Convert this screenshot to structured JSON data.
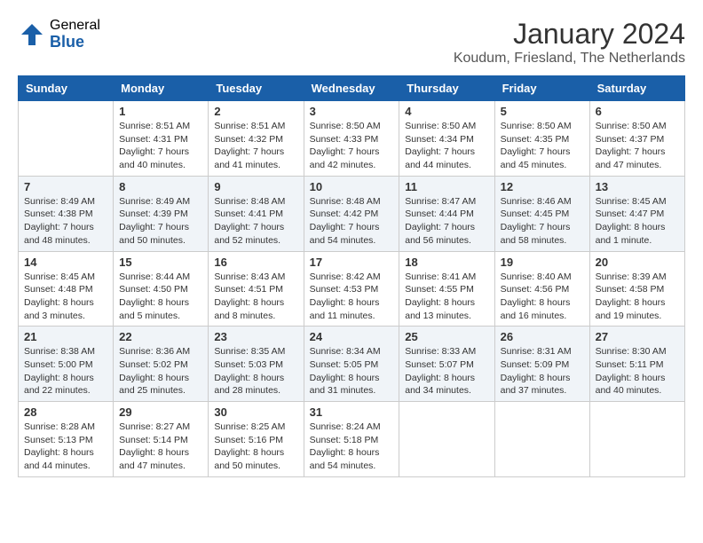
{
  "header": {
    "logo": {
      "general": "General",
      "blue": "Blue"
    },
    "title": "January 2024",
    "location": "Koudum, Friesland, The Netherlands"
  },
  "calendar": {
    "days_of_week": [
      "Sunday",
      "Monday",
      "Tuesday",
      "Wednesday",
      "Thursday",
      "Friday",
      "Saturday"
    ],
    "weeks": [
      [
        {
          "day": "",
          "info": ""
        },
        {
          "day": "1",
          "info": "Sunrise: 8:51 AM\nSunset: 4:31 PM\nDaylight: 7 hours\nand 40 minutes."
        },
        {
          "day": "2",
          "info": "Sunrise: 8:51 AM\nSunset: 4:32 PM\nDaylight: 7 hours\nand 41 minutes."
        },
        {
          "day": "3",
          "info": "Sunrise: 8:50 AM\nSunset: 4:33 PM\nDaylight: 7 hours\nand 42 minutes."
        },
        {
          "day": "4",
          "info": "Sunrise: 8:50 AM\nSunset: 4:34 PM\nDaylight: 7 hours\nand 44 minutes."
        },
        {
          "day": "5",
          "info": "Sunrise: 8:50 AM\nSunset: 4:35 PM\nDaylight: 7 hours\nand 45 minutes."
        },
        {
          "day": "6",
          "info": "Sunrise: 8:50 AM\nSunset: 4:37 PM\nDaylight: 7 hours\nand 47 minutes."
        }
      ],
      [
        {
          "day": "7",
          "info": "Sunrise: 8:49 AM\nSunset: 4:38 PM\nDaylight: 7 hours\nand 48 minutes."
        },
        {
          "day": "8",
          "info": "Sunrise: 8:49 AM\nSunset: 4:39 PM\nDaylight: 7 hours\nand 50 minutes."
        },
        {
          "day": "9",
          "info": "Sunrise: 8:48 AM\nSunset: 4:41 PM\nDaylight: 7 hours\nand 52 minutes."
        },
        {
          "day": "10",
          "info": "Sunrise: 8:48 AM\nSunset: 4:42 PM\nDaylight: 7 hours\nand 54 minutes."
        },
        {
          "day": "11",
          "info": "Sunrise: 8:47 AM\nSunset: 4:44 PM\nDaylight: 7 hours\nand 56 minutes."
        },
        {
          "day": "12",
          "info": "Sunrise: 8:46 AM\nSunset: 4:45 PM\nDaylight: 7 hours\nand 58 minutes."
        },
        {
          "day": "13",
          "info": "Sunrise: 8:45 AM\nSunset: 4:47 PM\nDaylight: 8 hours\nand 1 minute."
        }
      ],
      [
        {
          "day": "14",
          "info": "Sunrise: 8:45 AM\nSunset: 4:48 PM\nDaylight: 8 hours\nand 3 minutes."
        },
        {
          "day": "15",
          "info": "Sunrise: 8:44 AM\nSunset: 4:50 PM\nDaylight: 8 hours\nand 5 minutes."
        },
        {
          "day": "16",
          "info": "Sunrise: 8:43 AM\nSunset: 4:51 PM\nDaylight: 8 hours\nand 8 minutes."
        },
        {
          "day": "17",
          "info": "Sunrise: 8:42 AM\nSunset: 4:53 PM\nDaylight: 8 hours\nand 11 minutes."
        },
        {
          "day": "18",
          "info": "Sunrise: 8:41 AM\nSunset: 4:55 PM\nDaylight: 8 hours\nand 13 minutes."
        },
        {
          "day": "19",
          "info": "Sunrise: 8:40 AM\nSunset: 4:56 PM\nDaylight: 8 hours\nand 16 minutes."
        },
        {
          "day": "20",
          "info": "Sunrise: 8:39 AM\nSunset: 4:58 PM\nDaylight: 8 hours\nand 19 minutes."
        }
      ],
      [
        {
          "day": "21",
          "info": "Sunrise: 8:38 AM\nSunset: 5:00 PM\nDaylight: 8 hours\nand 22 minutes."
        },
        {
          "day": "22",
          "info": "Sunrise: 8:36 AM\nSunset: 5:02 PM\nDaylight: 8 hours\nand 25 minutes."
        },
        {
          "day": "23",
          "info": "Sunrise: 8:35 AM\nSunset: 5:03 PM\nDaylight: 8 hours\nand 28 minutes."
        },
        {
          "day": "24",
          "info": "Sunrise: 8:34 AM\nSunset: 5:05 PM\nDaylight: 8 hours\nand 31 minutes."
        },
        {
          "day": "25",
          "info": "Sunrise: 8:33 AM\nSunset: 5:07 PM\nDaylight: 8 hours\nand 34 minutes."
        },
        {
          "day": "26",
          "info": "Sunrise: 8:31 AM\nSunset: 5:09 PM\nDaylight: 8 hours\nand 37 minutes."
        },
        {
          "day": "27",
          "info": "Sunrise: 8:30 AM\nSunset: 5:11 PM\nDaylight: 8 hours\nand 40 minutes."
        }
      ],
      [
        {
          "day": "28",
          "info": "Sunrise: 8:28 AM\nSunset: 5:13 PM\nDaylight: 8 hours\nand 44 minutes."
        },
        {
          "day": "29",
          "info": "Sunrise: 8:27 AM\nSunset: 5:14 PM\nDaylight: 8 hours\nand 47 minutes."
        },
        {
          "day": "30",
          "info": "Sunrise: 8:25 AM\nSunset: 5:16 PM\nDaylight: 8 hours\nand 50 minutes."
        },
        {
          "day": "31",
          "info": "Sunrise: 8:24 AM\nSunset: 5:18 PM\nDaylight: 8 hours\nand 54 minutes."
        },
        {
          "day": "",
          "info": ""
        },
        {
          "day": "",
          "info": ""
        },
        {
          "day": "",
          "info": ""
        }
      ]
    ]
  }
}
